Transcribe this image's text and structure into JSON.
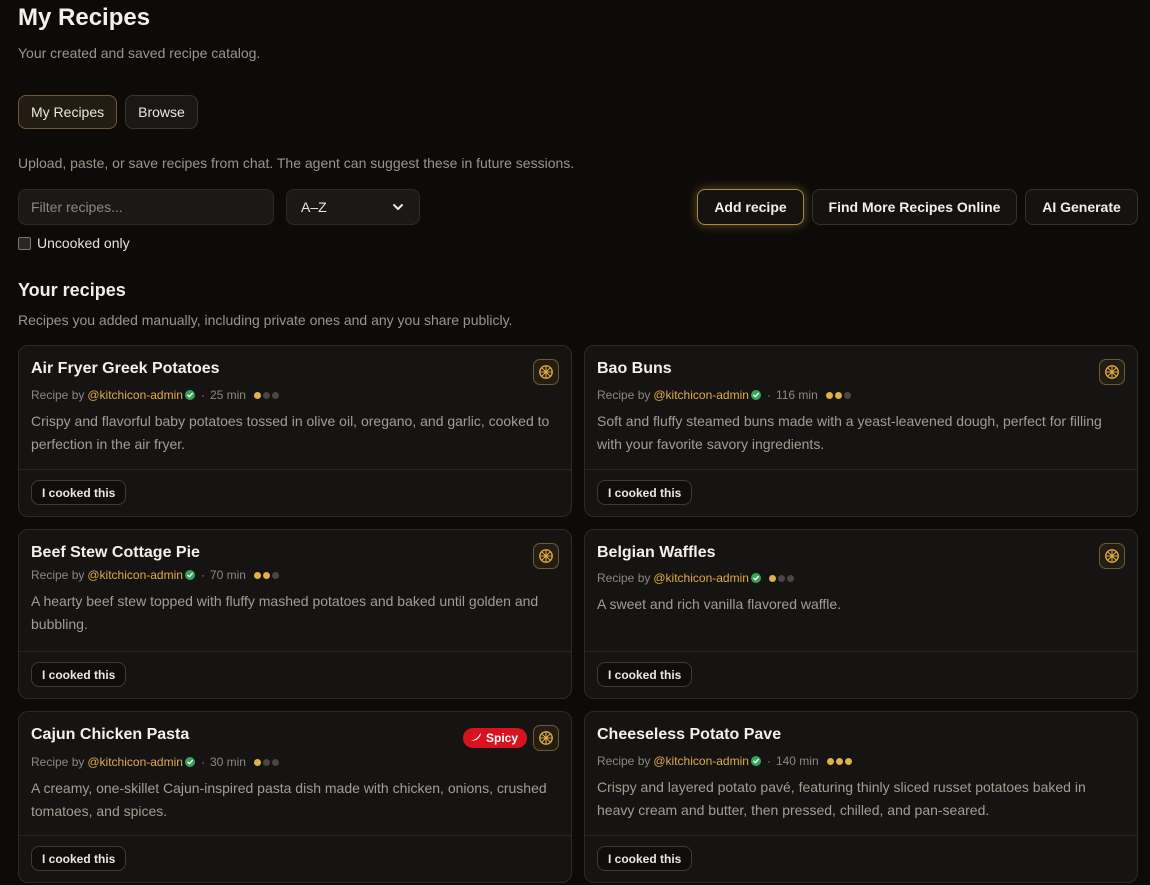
{
  "header": {
    "title": "My Recipes",
    "subtitle": "Your created and saved recipe catalog."
  },
  "tabs": [
    {
      "label": "My Recipes",
      "active": true
    },
    {
      "label": "Browse",
      "active": false
    }
  ],
  "hint": "Upload, paste, or save recipes from chat. The agent can suggest these in future sessions.",
  "filter": {
    "placeholder": "Filter recipes..."
  },
  "sort": {
    "selected": "A–Z"
  },
  "uncooked_only": {
    "label": "Uncooked only",
    "checked": false
  },
  "actions": {
    "add": "Add recipe",
    "find": "Find More Recipes Online",
    "ai": "AI Generate"
  },
  "section": {
    "title": "Your recipes",
    "subtitle": "Recipes you added manually, including private ones and any you share publicly."
  },
  "recipes": [
    {
      "title": "Air Fryer Greek Potatoes",
      "by": "Recipe by",
      "author": "@kitchicon-admin",
      "time": "25 min",
      "difficulty": 1,
      "description": "Crispy and flavorful baby potatoes tossed in olive oil, oregano, and garlic, cooked to perfection in the air fryer.",
      "spicy": false,
      "cooked_label": "I cooked this"
    },
    {
      "title": "Bao Buns",
      "by": "Recipe by",
      "author": "@kitchicon-admin",
      "time": "116 min",
      "difficulty": 2,
      "description": "Soft and fluffy steamed buns made with a yeast-leavened dough, perfect for filling with your favorite savory ingredients.",
      "spicy": false,
      "cooked_label": "I cooked this"
    },
    {
      "title": "Beef Stew Cottage Pie",
      "by": "Recipe by",
      "author": "@kitchicon-admin",
      "time": "70 min",
      "difficulty": 2,
      "description": "A hearty beef stew topped with fluffy mashed potatoes and baked until golden and bubbling.",
      "spicy": false,
      "cooked_label": "I cooked this"
    },
    {
      "title": "Belgian Waffles",
      "by": "Recipe by",
      "author": "@kitchicon-admin",
      "time": "",
      "difficulty": 1,
      "description": "A sweet and rich vanilla flavored waffle.",
      "spicy": false,
      "cooked_label": "I cooked this"
    },
    {
      "title": "Cajun Chicken Pasta",
      "by": "Recipe by",
      "author": "@kitchicon-admin",
      "time": "30 min",
      "difficulty": 1,
      "description": "A creamy, one-skillet Cajun-inspired pasta dish made with chicken, onions, crushed tomatoes, and spices.",
      "spicy": true,
      "spicy_label": "Spicy",
      "cooked_label": "I cooked this"
    },
    {
      "title": "Cheeseless Potato Pave",
      "by": "Recipe by",
      "author": "@kitchicon-admin",
      "time": "140 min",
      "difficulty": 3,
      "description": "Crispy and layered potato pavé, featuring thinly sliced russet potatoes baked in heavy cream and butter, then pressed, chilled, and pan-seared.",
      "spicy": false,
      "cooked_label": "I cooked this"
    }
  ],
  "colors": {
    "background": "#0d0b09",
    "accent": "#e0a94a",
    "spicy": "#d8131f",
    "verified": "#3aa35a"
  }
}
